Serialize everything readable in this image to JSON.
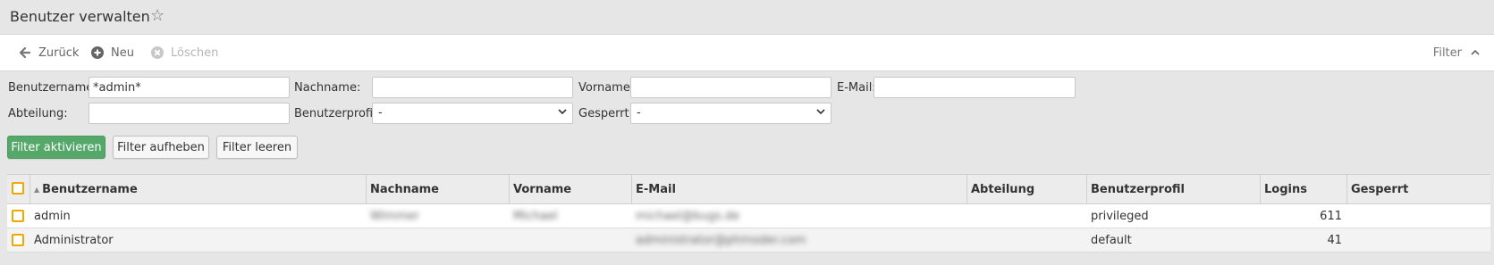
{
  "header": {
    "title": "Benutzer verwalten",
    "favorite_icon": "star-outline-icon"
  },
  "toolbar": {
    "back_label": "Zurück",
    "new_label": "Neu",
    "delete_label": "Löschen",
    "filter_label": "Filter"
  },
  "filters": {
    "username_label": "Benutzername:",
    "username_value": "*admin*",
    "lastname_label": "Nachname:",
    "lastname_value": "",
    "firstname_label": "Vorname:",
    "firstname_value": "",
    "email_label": "E-Mail:",
    "email_value": "",
    "department_label": "Abteilung:",
    "department_value": "",
    "profile_label": "Benutzerprofil:",
    "profile_value": "-",
    "locked_label": "Gesperrt:",
    "locked_value": "-",
    "apply_button": "Filter aktivieren",
    "clear_button": "Filter aufheben",
    "empty_button": "Filter leeren"
  },
  "grid": {
    "columns": [
      "Benutzername",
      "Nachname",
      "Vorname",
      "E-Mail",
      "Abteilung",
      "Benutzerprofil",
      "Logins",
      "Gesperrt"
    ],
    "rows": [
      {
        "username": "admin",
        "lastname": "Wimmer",
        "firstname": "Michael",
        "email": "michael@bugs.de",
        "department": "",
        "profile": "privileged",
        "logins": "611",
        "locked": ""
      },
      {
        "username": "Administrator",
        "lastname": "",
        "firstname": "",
        "email": "administrator@phmoder.com",
        "department": "",
        "profile": "default",
        "logins": "41",
        "locked": ""
      }
    ]
  },
  "colors": {
    "accent_green": "#56a86a",
    "checkbox_orange": "#f0a800"
  }
}
